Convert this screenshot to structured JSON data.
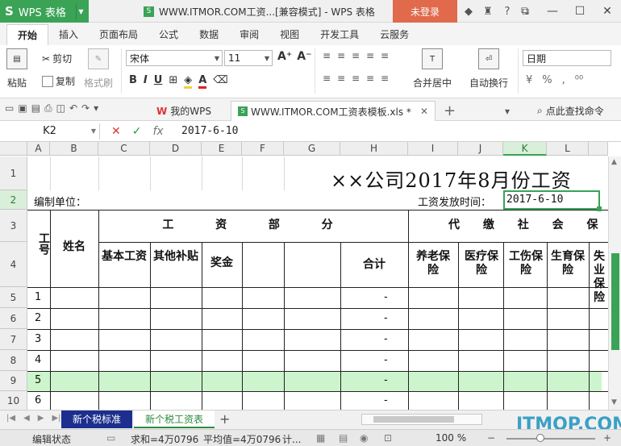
{
  "titlebar": {
    "app_name": "WPS 表格",
    "app_logo": "S",
    "document_title": "WWW.ITMOR.COM工资...[兼容模式] - WPS 表格",
    "login_label": "未登录",
    "icons": [
      "skin-icon",
      "shirt-icon",
      "help-icon",
      "more-icon"
    ],
    "window_controls": [
      "restore-icon",
      "minimize-icon",
      "maximize-icon",
      "close-icon"
    ]
  },
  "ribbon_tabs": [
    "开始",
    "插入",
    "页面布局",
    "公式",
    "数据",
    "审阅",
    "视图",
    "开发工具",
    "云服务"
  ],
  "ribbon": {
    "paste_label": "粘贴",
    "cut_label": "剪切",
    "copy_label": "复制",
    "format_painter_label": "格式刷",
    "font_name": "宋体",
    "font_size": "11",
    "bold": "B",
    "italic": "I",
    "underline": "U",
    "merge_center_label": "合并居中",
    "wrap_text_label": "自动换行",
    "number_format": "日期"
  },
  "doctabs": {
    "tab1_label": "我的WPS",
    "tab2_label": "WWW.ITMOR.COM工资表模板.xls *",
    "search_label": "点此查找命令"
  },
  "formula_bar": {
    "name_box": "K2",
    "formula": "2017-6-10"
  },
  "columns": [
    "A",
    "B",
    "C",
    "D",
    "E",
    "F",
    "G",
    "H",
    "I",
    "J",
    "K",
    "L"
  ],
  "rows": [
    "1",
    "2",
    "3",
    "4",
    "5",
    "6",
    "7",
    "8",
    "9",
    "10"
  ],
  "sheet": {
    "title": "××公司2017年8月份工资",
    "unit_label": "编制单位：",
    "pay_date_label": "工资发放时间：",
    "pay_date_value": "2017-6-10",
    "header_id": "工号",
    "header_name": "姓名",
    "header_wage_section": "工  资  部  分",
    "header_insurance_section": "代 缴 社 会 保 险",
    "wage_cols": [
      "基本工资",
      "其他补贴",
      "奖金",
      "",
      "",
      "合计"
    ],
    "insurance_cols": [
      "养老保险",
      "医疗保险",
      "工伤保险",
      "生育保险",
      "失业保险"
    ],
    "employee_ids": [
      "1",
      "2",
      "3",
      "4",
      "5",
      "6"
    ],
    "totals": [
      "-",
      "-",
      "-",
      "-",
      "-",
      "-"
    ]
  },
  "sheet_tabs": [
    "新个税标准",
    "新个税工资表"
  ],
  "watermark": "ITMOP.COM",
  "status": {
    "mode": "编辑状态",
    "sum": "求和=4万0796",
    "average": "平均值=4万0796",
    "count": "计...",
    "zoom": "100 %"
  },
  "colors": {
    "accent": "#3aa356",
    "login": "#e06a4b",
    "selected_row": "#cdf5cd",
    "sheet_tab_first": "#1c2f8e"
  }
}
